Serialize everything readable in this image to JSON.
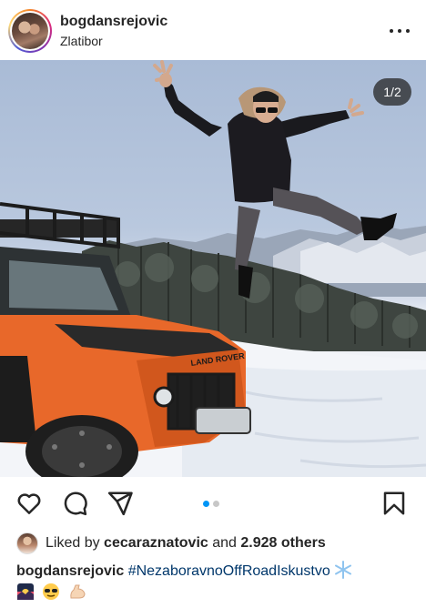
{
  "post": {
    "username": "bogdansrejovic",
    "location": "Zlatibor",
    "image_counter": "1/2",
    "carousel": {
      "total": 2,
      "current": 1
    }
  },
  "likes": {
    "prefix": "Liked by",
    "user": "cecaraznatovic",
    "conjunction": "and",
    "others": "2.928 others"
  },
  "caption": {
    "username": "bogdansrejovic",
    "hashtag": "#NezaboravnoOffRoadIskustvo",
    "emojis": [
      "snowflake-emoji",
      "sunset-emoji",
      "sunglasses-emoji",
      "flexed-biceps-emoji"
    ]
  },
  "icons": {
    "more": "more-horizontal-icon",
    "like": "heart-icon",
    "comment": "comment-icon",
    "share": "paper-plane-icon",
    "save": "bookmark-icon"
  },
  "colors": {
    "text": "#262626",
    "hashtag": "#00376b",
    "carousel_active": "#0095f6",
    "vehicle": "#e8682a"
  }
}
